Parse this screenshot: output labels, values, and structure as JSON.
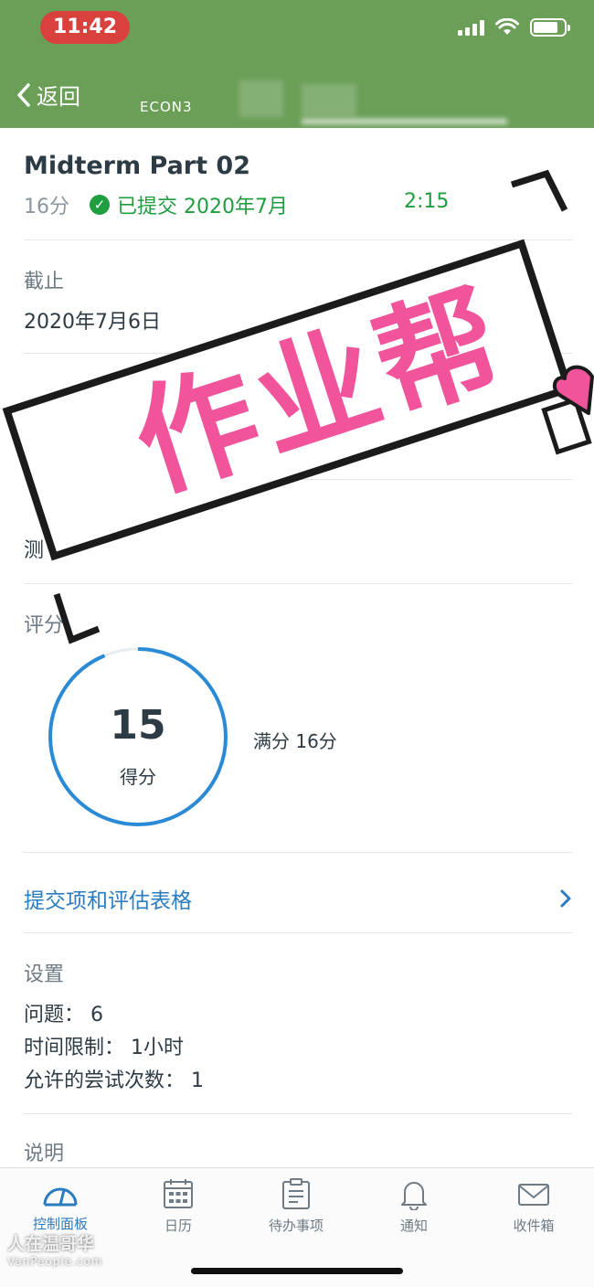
{
  "status_bar": {
    "time": "11:42"
  },
  "nav": {
    "back_label": "返回",
    "course_code": "ECON3"
  },
  "assignment": {
    "title": "Midterm Part 02",
    "points": "16分",
    "submitted_text": "已提交 2020年7月",
    "submitted_time": "2:15"
  },
  "due": {
    "label": "截止",
    "value": "2020年7月6日"
  },
  "type_row": {
    "value_fragment": "测"
  },
  "grade": {
    "label": "评分",
    "score": "15",
    "score_label": "得分",
    "max_text": "满分 16分",
    "fraction": 0.9375
  },
  "submission_link": {
    "label": "提交项和评估表格"
  },
  "settings": {
    "label": "设置",
    "questions": "问题： 6",
    "time_limit": "时间限制： 1小时",
    "attempts": "允许的尝试次数： 1"
  },
  "description": {
    "label": "说明"
  },
  "watermark": {
    "text": "作业帮"
  },
  "site_watermark": {
    "name": "人在温哥华",
    "url": "VanPeople.com"
  },
  "tabs": [
    {
      "label": "控制面板",
      "icon": "dashboard-icon",
      "active": true
    },
    {
      "label": "日历",
      "icon": "calendar-icon",
      "active": false
    },
    {
      "label": "待办事项",
      "icon": "todo-icon",
      "active": false
    },
    {
      "label": "通知",
      "icon": "bell-icon",
      "active": false
    },
    {
      "label": "收件箱",
      "icon": "inbox-icon",
      "active": false
    }
  ],
  "colors": {
    "nav_bg": "#6b9f57",
    "accent": "#2b7bbf",
    "success": "#1f9d3f",
    "watermark": "#f2549b"
  }
}
